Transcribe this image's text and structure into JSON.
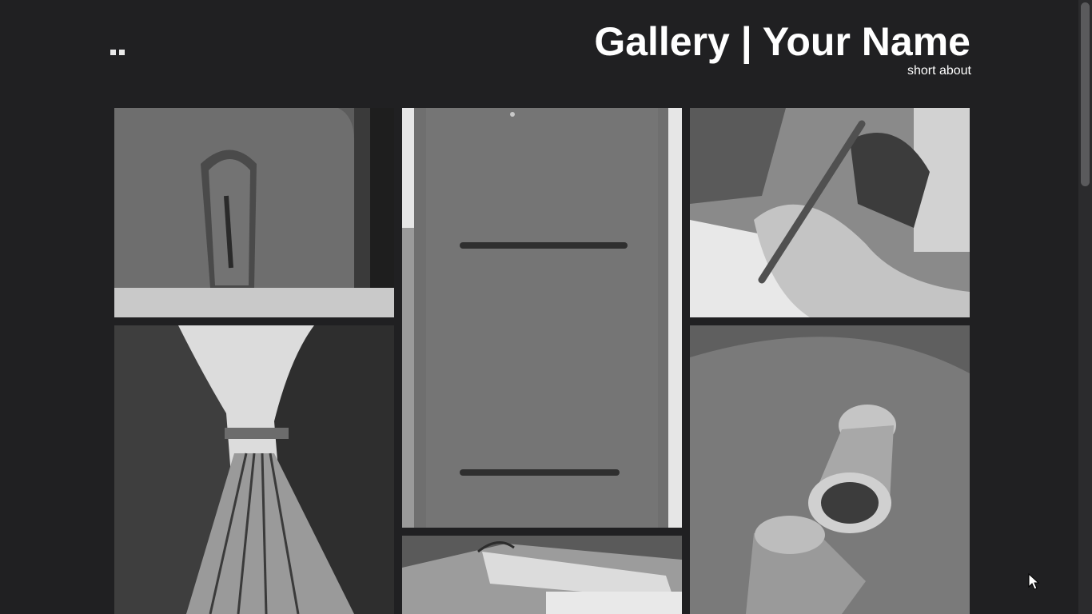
{
  "header": {
    "logo_icon": "dots-logo-icon",
    "title": "Gallery | Your Name",
    "subtitle": "short about"
  },
  "gallery": {
    "photos": [
      {
        "id": "hook",
        "subject": "metal coat hook on a chair back"
      },
      {
        "id": "ladder",
        "subject": "concrete pillar with two metal rungs"
      },
      {
        "id": "writing",
        "subject": "hand writing with a pen in a notebook"
      },
      {
        "id": "railway",
        "subject": "railway tracks between trees under a bridge"
      },
      {
        "id": "cups",
        "subject": "stacked paper cups lying on a table"
      },
      {
        "id": "notebooks",
        "subject": "spiral notebooks and books stacked"
      }
    ]
  },
  "colors": {
    "background": "#202022",
    "title": "#ffffff"
  }
}
